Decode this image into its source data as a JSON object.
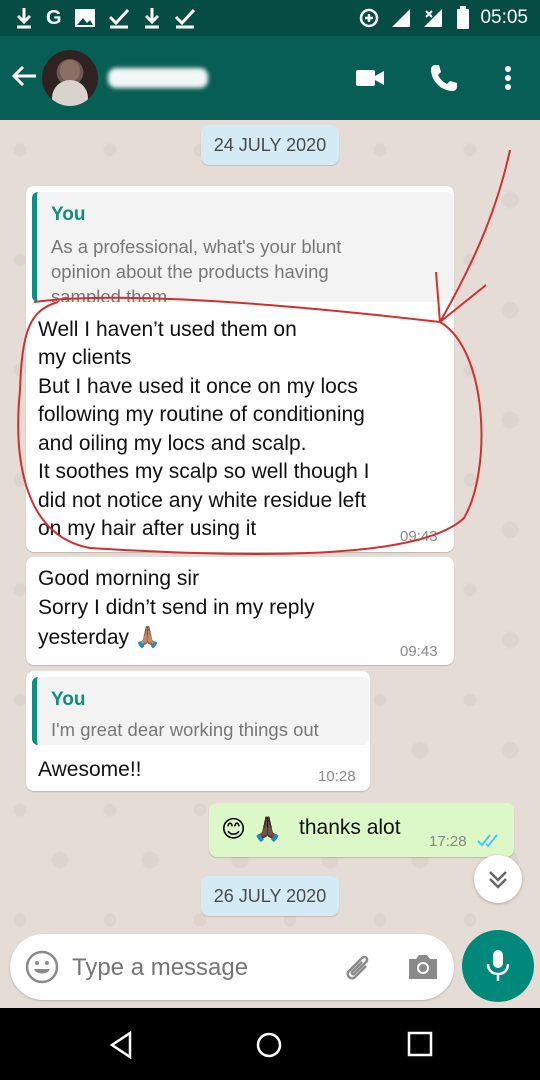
{
  "status_bar": {
    "time": "05:05",
    "left_icons": [
      "download-icon",
      "google-icon",
      "image-icon",
      "check-icon",
      "download-icon",
      "check-icon"
    ]
  },
  "app_bar": {
    "contact_name": "",
    "icons": [
      "back-arrow-icon",
      "video-call-icon",
      "phone-icon",
      "more-vert-icon"
    ]
  },
  "chat": {
    "date_labels": [
      "24 JULY 2020",
      "26 JULY 2020"
    ],
    "messages": [
      {
        "reply_to": {
          "name": "You",
          "text_lines": [
            "As a professional, what's your blunt",
            "opinion about the products having",
            "sampled them"
          ]
        },
        "text_lines": [
          "Well I haven’t used them on",
          "my clients",
          "But I have used it once on my locs",
          "following my routine of conditioning",
          "and oiling my locs and scalp.",
          "It soothes my scalp so well though I",
          "did not notice any white residue left",
          "on my hair after using it"
        ],
        "time": "09:43"
      },
      {
        "text_lines": [
          "Good morning sir",
          "Sorry I didn’t send in my reply",
          "yesterday 🙏🏽"
        ],
        "time": "09:43"
      },
      {
        "reply_to": {
          "name": "You",
          "text_lines": [
            "I'm great dear working things out"
          ]
        },
        "text_lines": [
          "Awesome!!"
        ],
        "time": "10:28"
      },
      {
        "outgoing": true,
        "text": "thanks alot",
        "emoji": "😊 🙏🏿",
        "time": "17:28",
        "status": "read"
      }
    ]
  },
  "input": {
    "placeholder": "Type a message",
    "icons": [
      "emoji-icon",
      "attach-icon",
      "camera-icon",
      "mic-icon"
    ]
  },
  "colors": {
    "header": "#075e54",
    "status_bar": "#054d44",
    "accent": "#00897b",
    "outgoing_bubble": "#dcf8c6",
    "annotation": "#d32f2f"
  }
}
